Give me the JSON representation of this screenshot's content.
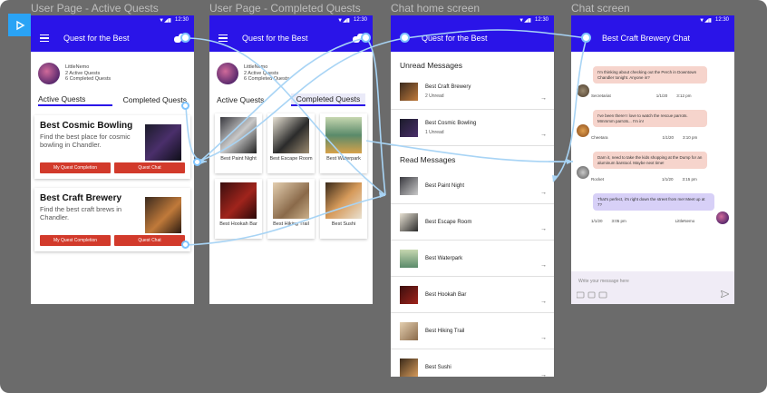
{
  "frames": {
    "active": "User Page - Active Quests",
    "completed": "User Page - Completed Quests",
    "home": "Chat home screen",
    "chat": "Chat screen"
  },
  "status_time": "12:30",
  "app_title": "Quest for the Best",
  "profile": {
    "name": "LittleNemo",
    "active_count": "2 Active Quests",
    "completed_count": "6 Completed Quests"
  },
  "tabs": {
    "active": "Active Quests",
    "completed": "Completed Quests"
  },
  "active_quests": [
    {
      "title": "Best Cosmic Bowling",
      "desc": "Find the best place for cosmic bowling in Chandler.",
      "btn_completion": "My Quest Completion",
      "btn_chat": "Quest Chat"
    },
    {
      "title": "Best Craft Brewery",
      "desc": "Find the best craft brews in Chandler.",
      "btn_completion": "My Quest Completion",
      "btn_chat": "Quest Chat"
    }
  ],
  "completed_quests": [
    "Best Paint Night",
    "Best Escape Room",
    "Best Waterpark",
    "Best Hookah Bar",
    "Best Hiking Trail",
    "Best Sushi"
  ],
  "chat_home": {
    "unread_header": "Unread Messages",
    "read_header": "Read Messages",
    "unread": [
      {
        "name": "Best Craft Brewery",
        "sub": "2 Unread"
      },
      {
        "name": "Best Cosmic Bowling",
        "sub": "1 Unread"
      }
    ],
    "read": [
      "Best Paint Night",
      "Best Escape Room",
      "Best Waterpark",
      "Best Hookah Bar",
      "Best Hiking Trail",
      "Best Sushi"
    ]
  },
  "chat": {
    "title": "Best Craft Brewery Chat",
    "messages": [
      {
        "text": "I'm thinking about checking out the Perch in Downtown Chandler tonight. Anyone in?",
        "sender": "Secretariat",
        "date": "1/1/20",
        "time": "3:12 pm"
      },
      {
        "text": "I've been there! I love to watch the rescue parrots. Mmmmm parrots... I'm in!",
        "sender": "Cheetara",
        "date": "1/1/20",
        "time": "3:10 pm"
      },
      {
        "text": "Darn it, need to take the kids shopping at the Dump for an aluminum barstool. Maybe next time!",
        "sender": "Rocket",
        "date": "1/1/20",
        "time": "3:15 pm"
      },
      {
        "text": "That's perfect, it's right down the street from me! Meet up at 7?",
        "sender": "LittleNemo",
        "date": "1/1/20",
        "time": "3:05 pm"
      }
    ],
    "composer_placeholder": "Write your message here"
  },
  "colors": {
    "appbar": "#2a14e8",
    "button": "#d23a2b",
    "flow": "#a8d4f5",
    "canvas": "#6b6b6b"
  }
}
